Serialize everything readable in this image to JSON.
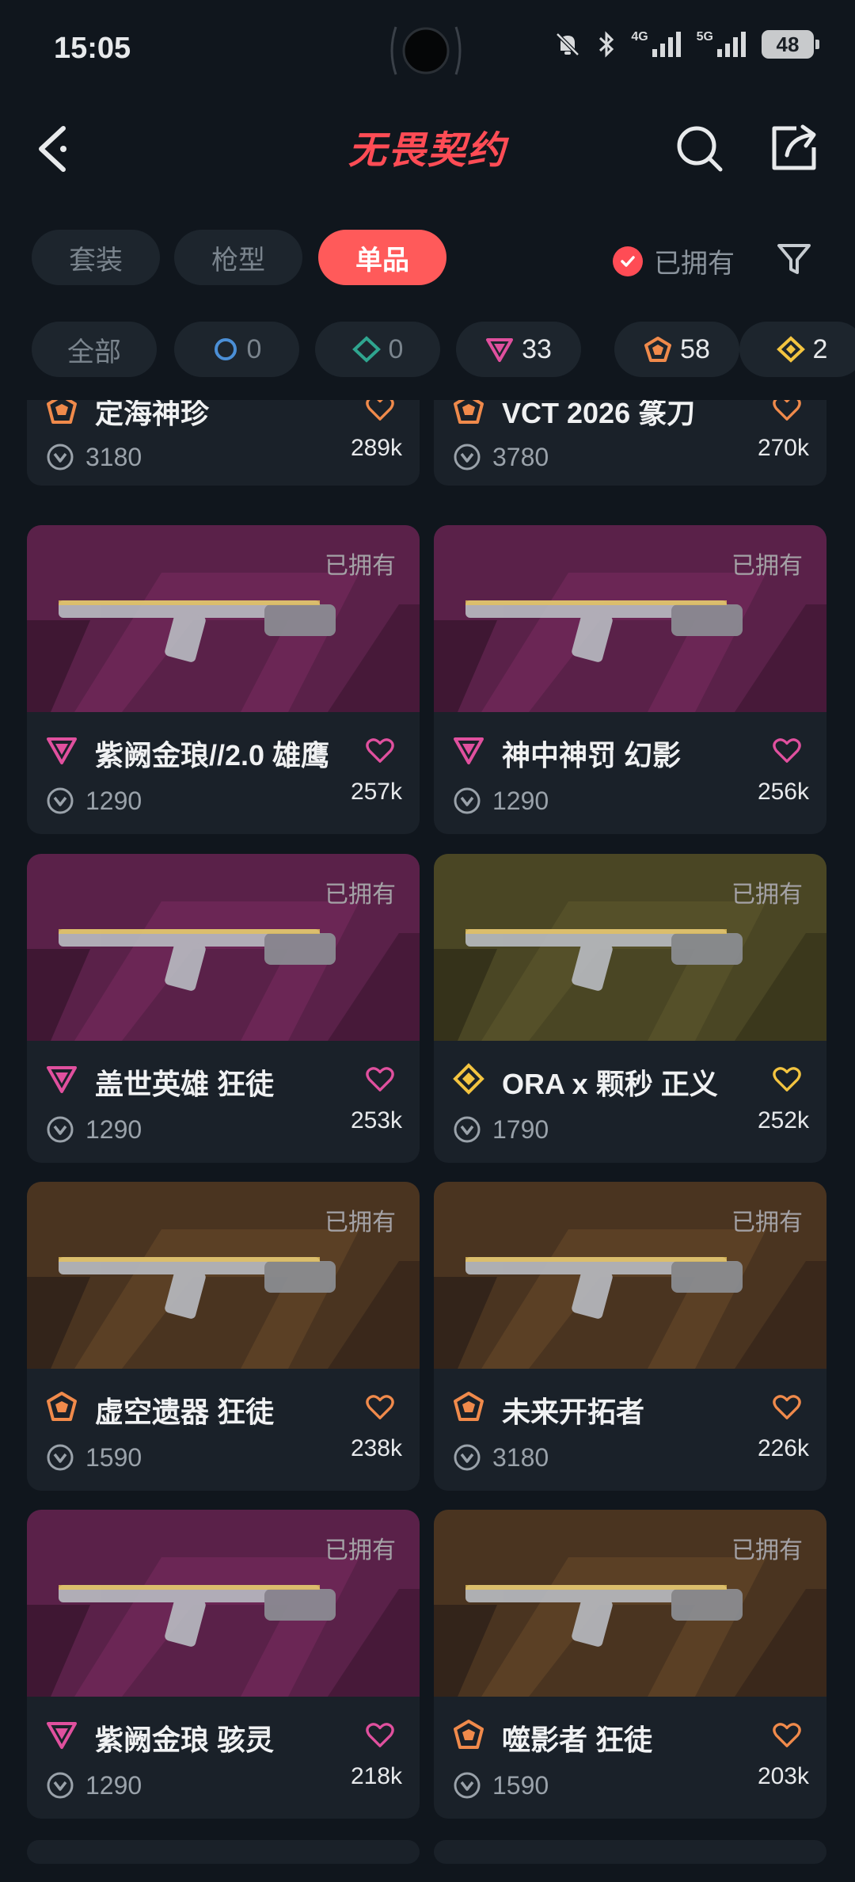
{
  "status": {
    "time": "15:05",
    "net1": "4G",
    "net2": "5G",
    "battery": "48"
  },
  "header": {
    "title": "无畏契约"
  },
  "tabs": [
    {
      "label": "套装"
    },
    {
      "label": "枪型"
    },
    {
      "label": "单品",
      "active": true
    }
  ],
  "owned_filter": {
    "label": "已拥有",
    "checked": true
  },
  "rarity_filters": [
    {
      "label": "全部"
    },
    {
      "tier": "select",
      "count": "0"
    },
    {
      "tier": "deluxe",
      "count": "0"
    },
    {
      "tier": "premium",
      "count": "33"
    },
    {
      "tier": "exclusive",
      "count": "58"
    },
    {
      "tier": "ultra",
      "count": "2"
    }
  ],
  "colors": {
    "accent": "#ff5a5a",
    "premium": "#e0509e",
    "exclusive": "#f08a4b",
    "ultra": "#f3c440",
    "select": "#4b8fd6",
    "deluxe": "#2fa58f"
  },
  "items": [
    {
      "name": "定海神珍",
      "price": "3180",
      "likes": "289k",
      "tier": "exclusive",
      "owned": "",
      "bg": "none"
    },
    {
      "name": "VCT 2026 篆刀",
      "price": "3780",
      "likes": "270k",
      "tier": "exclusive",
      "owned": "",
      "bg": "none"
    },
    {
      "name": "紫阙金琅//2.0 雄鹰",
      "price": "1290",
      "likes": "257k",
      "tier": "premium",
      "owned": "已拥有",
      "bg": "purple"
    },
    {
      "name": "神中神罚 幻影",
      "price": "1290",
      "likes": "256k",
      "tier": "premium",
      "owned": "已拥有",
      "bg": "purple"
    },
    {
      "name": "盖世英雄 狂徒",
      "price": "1290",
      "likes": "253k",
      "tier": "premium",
      "owned": "已拥有",
      "bg": "purple"
    },
    {
      "name": "ORA x 颗秒 正义",
      "price": "1790",
      "likes": "252k",
      "tier": "ultra",
      "owned": "已拥有",
      "bg": "olive"
    },
    {
      "name": "虚空遗器 狂徒",
      "price": "1590",
      "likes": "238k",
      "tier": "exclusive",
      "owned": "已拥有",
      "bg": "brown"
    },
    {
      "name": "未来开拓者",
      "price": "3180",
      "likes": "226k",
      "tier": "exclusive",
      "owned": "已拥有",
      "bg": "brown"
    },
    {
      "name": "紫阙金琅 骇灵",
      "price": "1290",
      "likes": "218k",
      "tier": "premium",
      "owned": "已拥有",
      "bg": "purple"
    },
    {
      "name": "噬影者 狂徒",
      "price": "1590",
      "likes": "203k",
      "tier": "exclusive",
      "owned": "已拥有",
      "bg": "brown"
    }
  ]
}
